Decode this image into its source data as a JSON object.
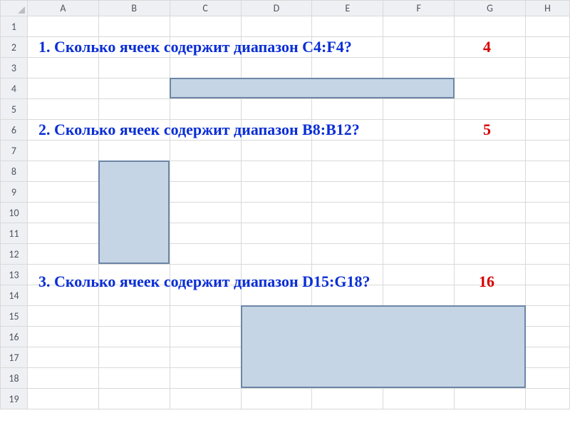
{
  "columns": [
    "A",
    "B",
    "C",
    "D",
    "E",
    "F",
    "G",
    "H"
  ],
  "rows": [
    "1",
    "2",
    "3",
    "4",
    "5",
    "6",
    "7",
    "8",
    "9",
    "10",
    "11",
    "12",
    "13",
    "14",
    "15",
    "16",
    "17",
    "18",
    "19"
  ],
  "q1": {
    "text": "1. Сколько ячеек содержит диапазон C4:F4?",
    "answer": "4"
  },
  "q2": {
    "text": "2. Сколько ячеек содержит диапазон B8:B12?",
    "answer": "5"
  },
  "q3": {
    "text": "3. Сколько ячеек содержит диапазон D15:G18?",
    "answer": "16"
  },
  "ranges": {
    "r1": "C4:F4",
    "r2": "B8:B12",
    "r3": "D15:G18"
  }
}
